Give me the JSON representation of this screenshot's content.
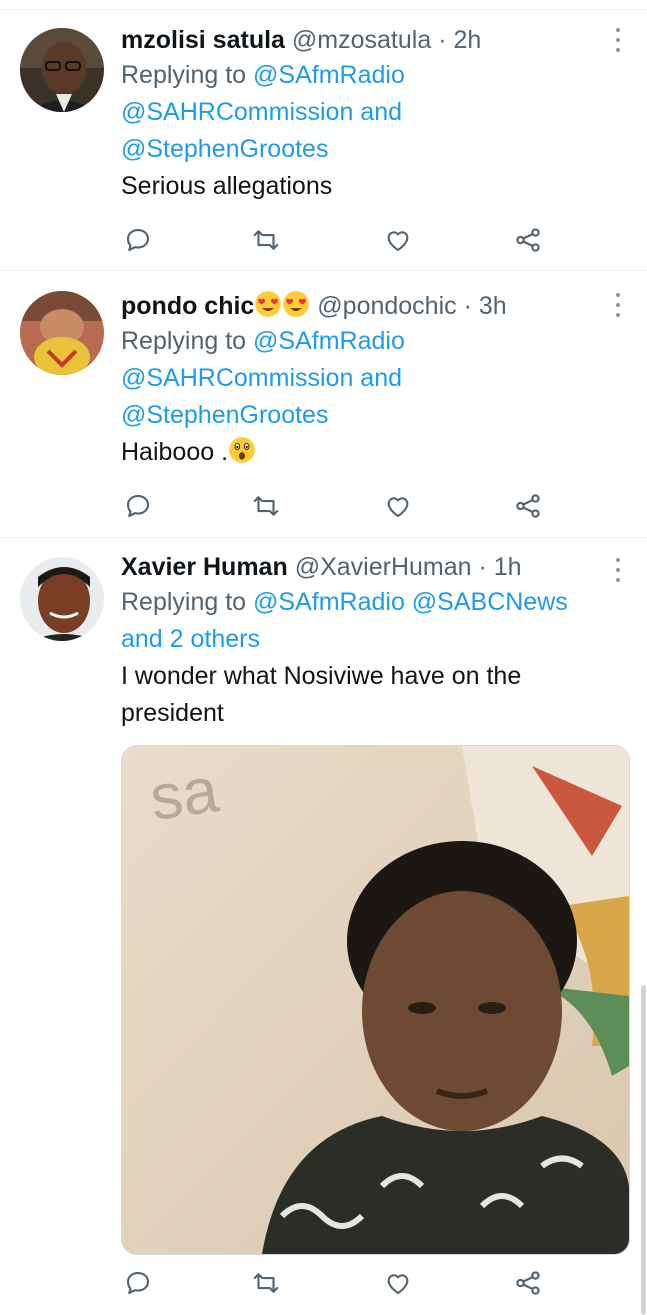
{
  "colors": {
    "accent": "#1d9bf0",
    "secondary_text": "#536471",
    "primary_text": "#0f1419",
    "divider": "#eff3f4"
  },
  "tweets": [
    {
      "display_name": "mzolisi satula",
      "handle": "@mzosatula",
      "separator": "·",
      "time": "2h",
      "replying_prefix": "Replying to",
      "reply_line1": "@SAfmRadio",
      "reply_line2": "@SAHRCommission and",
      "reply_line3": "@StephenGrootes",
      "text": "Serious allegations"
    },
    {
      "display_name": "pondo chic",
      "name_emojis": [
        "smiling-face-with-heart-eyes",
        "smiling-face-with-heart-eyes"
      ],
      "handle": "@pondochic",
      "separator": "·",
      "time": "3h",
      "replying_prefix": "Replying to",
      "reply_line1": "@SAfmRadio",
      "reply_line2": "@SAHRCommission and",
      "reply_line3": "@StephenGrootes",
      "text": "Haibooo .",
      "text_emoji": "astonished-face"
    },
    {
      "display_name": "Xavier Human",
      "handle": "@XavierHuman",
      "separator": "·",
      "time": "1h",
      "replying_prefix": "Replying to",
      "reply_line1": "@SAfmRadio @SABCNews",
      "reply_line2": "and 2 others",
      "text_line1": "I wonder what Nosiviwe have on the",
      "text_line2": "president",
      "media_logo_text": "sa"
    }
  ],
  "action_icons": [
    "reply-icon",
    "retweet-icon",
    "like-icon",
    "share-icon"
  ]
}
